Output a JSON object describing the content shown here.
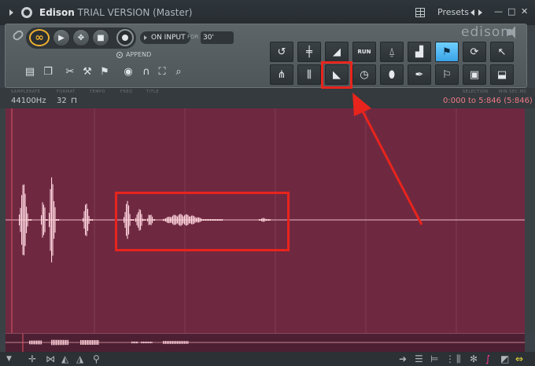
{
  "window": {
    "app_name": "Edison",
    "title_rest": "TRIAL VERSION (Master)",
    "presets_label": "Presets",
    "min_btn": "—",
    "max_btn": "□",
    "close_btn": "✕"
  },
  "transport": {
    "loop_symbol": "∞",
    "play_symbol": "▶",
    "record_mode_symbol": "✥",
    "stop_symbol": "■",
    "on_input_label": "ON INPUT",
    "for_label": "FOR",
    "duration_value": "30'",
    "append_label": "APPEND"
  },
  "logo": "edison",
  "tools_row1": [
    {
      "name": "undo-icon",
      "glyph": "↺"
    },
    {
      "name": "normalize-icon",
      "glyph": "╪"
    },
    {
      "name": "fade-in-icon",
      "glyph": "◢"
    },
    {
      "name": "run-scripts-icon",
      "glyph": "RUN"
    },
    {
      "name": "rocket-icon",
      "glyph": "⍙"
    },
    {
      "name": "spectrum-icon",
      "glyph": "▟"
    },
    {
      "name": "add-marker-icon",
      "glyph": "⚑"
    },
    {
      "name": "loop-convert-icon",
      "glyph": "⟳"
    },
    {
      "name": "cursor-icon",
      "glyph": "↖"
    }
  ],
  "tools_row2": [
    {
      "name": "split-icon",
      "glyph": "⋔"
    },
    {
      "name": "noise-icon",
      "glyph": "⫼"
    },
    {
      "name": "fade-out-icon",
      "glyph": "◣"
    },
    {
      "name": "time-stretch-icon",
      "glyph": "◷"
    },
    {
      "name": "drop-icon",
      "glyph": "⬮"
    },
    {
      "name": "feather-icon",
      "glyph": "✒"
    },
    {
      "name": "marker-tool-icon",
      "glyph": "⚐"
    },
    {
      "name": "save-icon",
      "glyph": "▣"
    },
    {
      "name": "export-icon",
      "glyph": "⬓"
    }
  ],
  "info": {
    "samplerate_label": "SAMPLERATE",
    "samplerate_value": "44100Hz",
    "format_label": "FORMAT",
    "format_value": "32",
    "tempo_label": "TEMPO",
    "freq_label": "FREQ",
    "title_label": "TITLE",
    "selection_label": "SELECTION",
    "minsec_label": "MIN:SEC:MS",
    "selection_value": "0:000 to 5:846 (5:846)"
  },
  "colors": {
    "wave_bg": "#6e2941",
    "wave_fg": "#ffd3dc",
    "highlight": "#e8241c",
    "active_tool": "#4db8f5"
  }
}
